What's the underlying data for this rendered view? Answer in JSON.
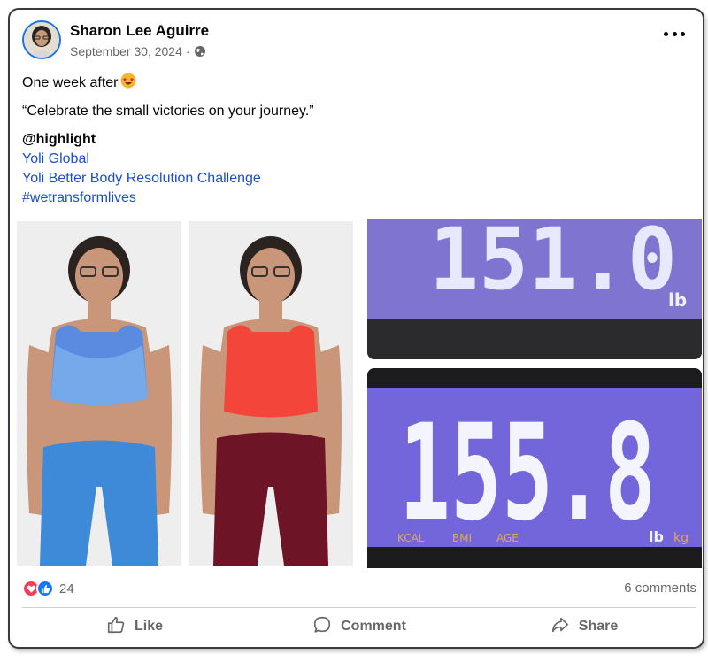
{
  "post": {
    "author": "Sharon Lee Aguirre",
    "date": "September 30, 2024",
    "separator": "·",
    "privacy_icon": "globe-icon",
    "more_icon": "more-options-icon"
  },
  "content": {
    "line1": "One week after",
    "line1_emoji": "star-struck-emoji",
    "quote": "“Celebrate the small victories on your journey.”",
    "mention": "@highlight",
    "links": [
      "Yoli Global",
      "Yoli Better Body Resolution Challenge",
      "#wetransformlives"
    ]
  },
  "photos": {
    "scale_before_reading": "155.8",
    "scale_after_reading": "151.0",
    "scale_unit": "lb",
    "scale_labels": [
      "KCAL",
      "BMI",
      "AGE",
      "lb",
      "kg"
    ]
  },
  "reactions": {
    "icons": [
      "love-icon",
      "like-icon"
    ],
    "count": "24",
    "comments": "6 comments"
  },
  "actions": {
    "like": "Like",
    "comment": "Comment",
    "share": "Share"
  },
  "colors": {
    "link": "#1b4fc9",
    "avatar_ring": "#1b74e4",
    "secondary_text": "#65676b",
    "love": "#f33e58",
    "like": "#1877f2",
    "lcd_glow": "#8a7cf0"
  }
}
